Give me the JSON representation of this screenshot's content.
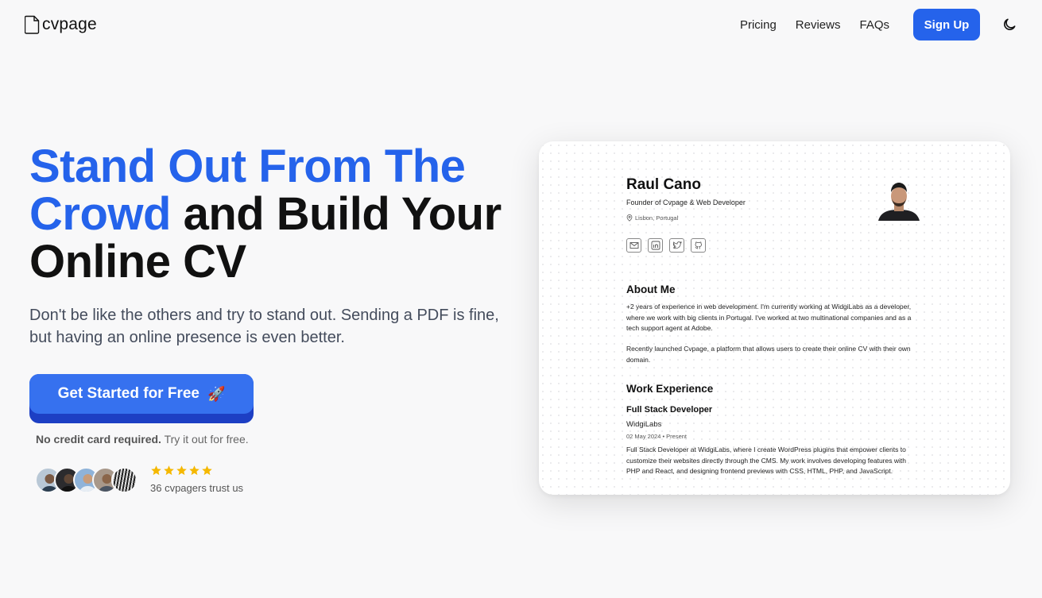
{
  "nav": {
    "brand": "cvpage",
    "links": [
      "Pricing",
      "Reviews",
      "FAQs"
    ],
    "signup_label": "Sign Up"
  },
  "hero": {
    "title_highlight": "Stand Out From The Crowd",
    "title_rest": "and Build Your Online CV",
    "subtitle": "Don't be like the others and try to stand out. Sending a PDF is fine, but having an online presence is even better.",
    "cta_label": "Get Started for Free",
    "cta_emoji": "🚀",
    "no_cc_bold": "No credit card required.",
    "no_cc_rest": "Try it out for free.",
    "rating": 5,
    "trust_text": "36 cvpagers trust us"
  },
  "cv": {
    "name": "Raul Cano",
    "role": "Founder of Cvpage & Web Developer",
    "location": "Lisbon, Portugal",
    "about_heading": "About Me",
    "about_p1": "+2 years of experience in web development. I'm currently working at WidgiLabs as a developer, where we work with big clients in Portugal. I've worked at two multinational companies and as a tech support agent at Adobe.",
    "about_p2": "Recently launched Cvpage, a platform that allows users to create their online CV with their own domain.",
    "work_heading": "Work Experience",
    "job_title": "Full Stack Developer",
    "company": "WidgiLabs",
    "dates": "02 May 2024 • Present",
    "job_desc": "Full Stack Developer at WidgiLabs, where I create WordPress plugins that empower clients to customize their websites directly through the CMS. My work involves developing features with PHP and React, and designing frontend previews with CSS, HTML, PHP, and JavaScript."
  },
  "colors": {
    "accent": "#2563eb",
    "star": "#f5b800"
  }
}
